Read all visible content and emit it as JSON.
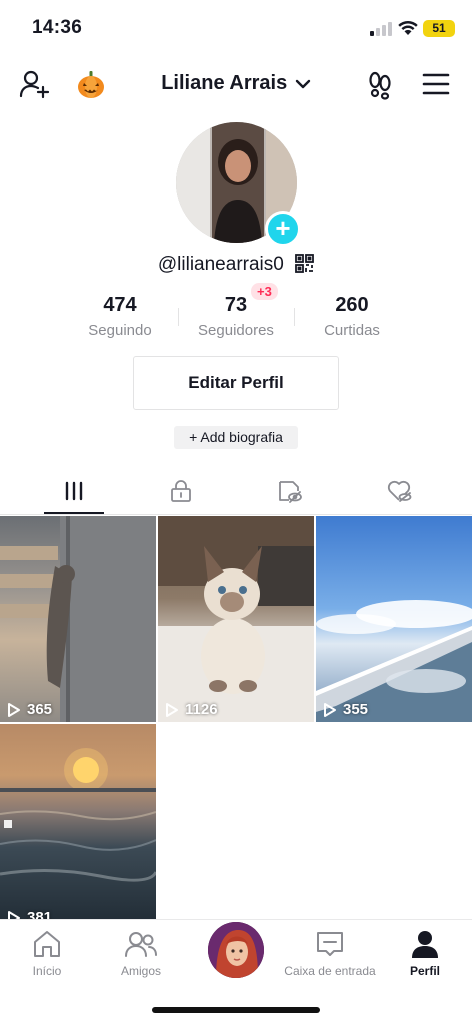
{
  "status_bar": {
    "time": "14:36",
    "battery": "51"
  },
  "header": {
    "title": "Liliane Arrais"
  },
  "profile": {
    "handle": "@lilianearrais0",
    "stats": [
      {
        "value": "474",
        "label": "Seguindo"
      },
      {
        "value": "73",
        "label": "Seguidores"
      },
      {
        "value": "260",
        "label": "Curtidas"
      }
    ],
    "new_followers_badge": "+3",
    "edit_button": "Editar Perfil",
    "bio_button": "+ Add biografia"
  },
  "tabs": [
    {
      "icon": "grid-icon",
      "active": true
    },
    {
      "icon": "lock-icon",
      "active": false
    },
    {
      "icon": "hidden-likes-icon",
      "active": false
    },
    {
      "icon": "liked-icon",
      "active": false
    }
  ],
  "videos": [
    {
      "views": "365",
      "subject": "cat-at-fridge"
    },
    {
      "views": "1126",
      "subject": "siamese-kitten"
    },
    {
      "views": "355",
      "subject": "airplane-wing-clouds"
    },
    {
      "views": "381",
      "subject": "beach-sunset"
    }
  ],
  "bottom_nav": {
    "home": "Início",
    "friends": "Amigos",
    "inbox": "Caixa de entrada",
    "profile": "Perfil"
  },
  "colors": {
    "accent_cyan": "#20d5ec",
    "badge_red": "#fe2c55",
    "battery_yellow": "#f2d30f",
    "text_primary": "#161823",
    "text_secondary": "#8a8b91"
  }
}
